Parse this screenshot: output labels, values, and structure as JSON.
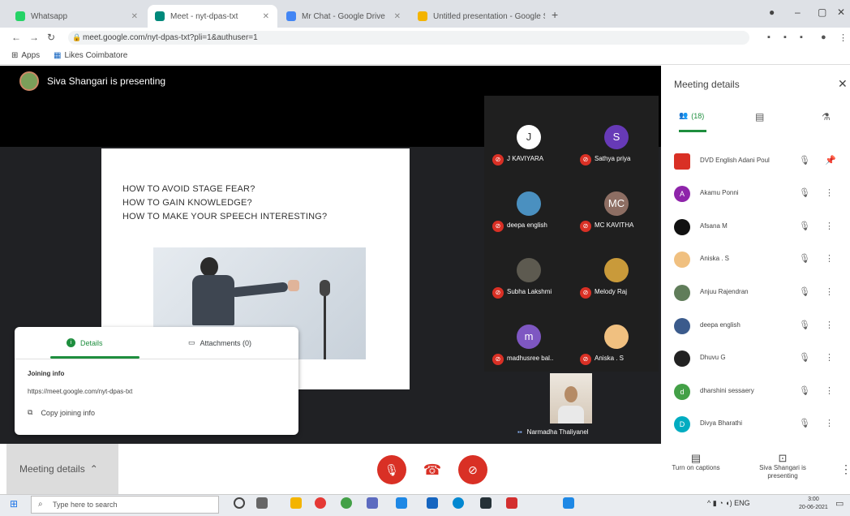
{
  "browser": {
    "tabs": [
      {
        "title": "Whatsapp",
        "color": "#25d366"
      },
      {
        "title": "Meet - nyt-dpas-txt",
        "color": "#00897b"
      },
      {
        "title": "Mr Chat - Google Drive",
        "color": "#4285f4"
      },
      {
        "title": "Untitled presentation - Google S",
        "color": "#f4b400"
      }
    ],
    "new_tab": "+",
    "url": "meet.google.com/nyt-dpas-txt?pli=1&authuser=1",
    "bookmarks": [
      "Apps",
      "Likes Coimbatore"
    ]
  },
  "meet": {
    "presenter_text": "Siva Shangari is presenting",
    "slide_lines": [
      "HOW TO AVOID STAGE FEAR?",
      "HOW TO GAIN KNOWLEDGE?",
      "HOW TO MAKE YOUR SPEECH INTERESTING?"
    ],
    "tiles": [
      {
        "initial": "J",
        "name": "J KAVIYARA",
        "color": "#ffffff",
        "text_color": "#333"
      },
      {
        "initial": "S",
        "name": "Sathya priya",
        "color": "#673ab7",
        "text_color": "#fff"
      },
      {
        "initial": "",
        "name": "deepa english",
        "color": "#4a90c0",
        "text_color": "#fff"
      },
      {
        "initial": "MC",
        "name": "MC KAVITHA",
        "color": "#8d6e63",
        "text_color": "#fff"
      },
      {
        "initial": "",
        "name": "Subha Lakshmi",
        "color": "#5d5a50",
        "text_color": "#fff"
      },
      {
        "initial": "",
        "name": "Melody Raj",
        "color": "#c99a3a",
        "text_color": "#fff"
      },
      {
        "initial": "m",
        "name": "madhusree bal..",
        "color": "#7e57c2",
        "text_color": "#fff"
      },
      {
        "initial": "",
        "name": "Aniska . S",
        "color": "#f0c080",
        "text_color": "#fff"
      }
    ],
    "self_name": "Narmadha Thaliyanel",
    "details_card": {
      "tab_details": "Details",
      "tab_attachments": "Attachments (0)",
      "joining_label": "Joining info",
      "link": "https://meet.google.com/nyt-dpas-txt",
      "copy_label": "Copy joining info"
    }
  },
  "panel": {
    "title": "Meeting details",
    "tab_people": "(18)",
    "people": [
      {
        "name": "DVD English Adani Poul",
        "initial": "",
        "color": "#d93025"
      },
      {
        "name": "Akamu Ponni",
        "initial": "A",
        "color": "#8e24aa"
      },
      {
        "name": "Afsana M",
        "initial": "",
        "color": "#111111"
      },
      {
        "name": "Aniska . S",
        "initial": "",
        "color": "#f0c080"
      },
      {
        "name": "Anjuu Rajendran",
        "initial": "",
        "color": "#607d5a"
      },
      {
        "name": "deepa english",
        "initial": "",
        "color": "#3b5b8c"
      },
      {
        "name": "Dhuvu G",
        "initial": "",
        "color": "#222222"
      },
      {
        "name": "dharshini sessaery",
        "initial": "d",
        "color": "#43a047"
      },
      {
        "name": "Divya Bharathi",
        "initial": "D",
        "color": "#00acc1"
      }
    ]
  },
  "bottom": {
    "meeting_details": "Meeting details",
    "captions_label": "Turn on captions",
    "presenting_label": "Siva Shangari is presenting"
  },
  "taskbar": {
    "search_placeholder": "Type here to search",
    "time": "3:00",
    "date": "20-06-2021",
    "lang": "ENG"
  },
  "colors": {
    "accent": "#1e8e3e",
    "danger": "#d93025"
  }
}
